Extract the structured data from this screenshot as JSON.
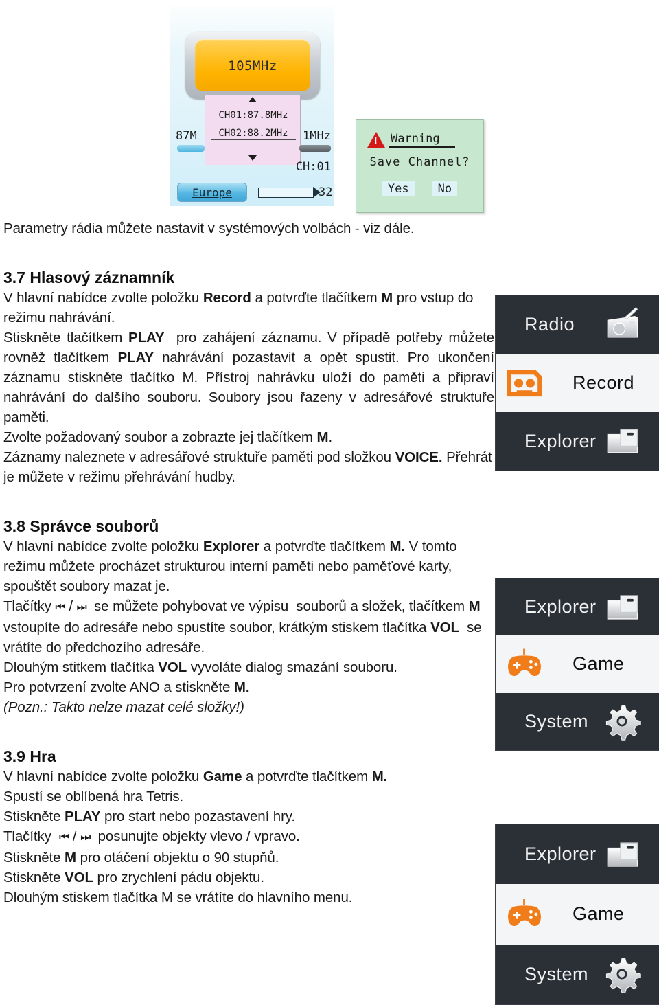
{
  "device_screens": {
    "radio": {
      "name": "radio-tuner-screen",
      "frequency": "105MHz",
      "channels": [
        "CH01:87.8MHz",
        "CH02:88.2MHz"
      ],
      "scale_min": "87M",
      "scale_max": "1MHz",
      "current_channel": "CH:01",
      "region": "Europe",
      "volume": "32"
    },
    "warning": {
      "name": "save-channel-dialog",
      "title": "Warning",
      "message": "Save  Channel?",
      "buttons": [
        "Yes",
        "No"
      ],
      "bg_color": "#c7e8ce",
      "icon_color": "#d31a18"
    }
  },
  "doc": {
    "intro": "Parametry rádia můžete nastavit v systémových volbách - viz dále.",
    "section_37": {
      "heading": "3.7 Hlasový záznamník",
      "paragraphs": [
        "V hlavní nabídce zvolte položku <b>Record</b> a potvrďte tlačítkem <b>M</b> pro vstup do režimu nahrávání.",
        "Stiskněte tlačítkem <b>PLAY</b>&nbsp; pro zahájení záznamu. V případě potřeby můžete rovněž tlačítkem <b>PLAY</b> nahrávání pozastavit a opět spustit. Pro ukončení záznamu stiskněte tlačítko M. Přístroj nahrávku uloží do paměti a připraví nahrávání do dalšího souboru. Soubory jsou řazeny v adresářové struktuře paměti.",
        "Zvolte požadovaný soubor a zobrazte jej tlačítkem <b>M</b>.",
        "Záznamy naleznete v adresářové struktuře paměti pod složkou <b>VOICE.</b> Přehrát je můžete v režimu přehrávání hudby."
      ]
    },
    "section_38": {
      "heading": "3.8 Správce souborů",
      "paragraphs": [
        "V hlavní nabídce zvolte položku <b>Explorer</b> a potvrďte tlačítkem <b>M.</b> V tomto režimu můžete procházet strukturou interní paměti nebo paměťové karty, spouštět soubory mazat je.",
        "Tlačítky <span class=\"glyph\">⏮</span> / <span class=\"glyph\">⏭</span>&nbsp; se můžete pohybovat ve výpisu&nbsp; souborů a složek, tlačítkem <b>M</b> vstoupíte do adresáře nebo spustíte soubor, krátkým stiskem tlačítka <b>VOL</b>&nbsp; se vrátíte do předchozího adresáře.",
        "Dlouhým stitkem tlačítka <b>VOL</b> vyvoláte dialog smazání souboru.",
        "Pro potvrzení zvolte ANO a stiskněte <b>M.</b>",
        "<i>(Pozn.: Takto nelze mazat celé složky!)</i>"
      ]
    },
    "section_39": {
      "heading": "3.9 Hra",
      "paragraphs": [
        "V hlavní nabídce zvolte položku <b>Game</b> a potvrďte tlačítkem <b>M.</b>",
        "Spustí se oblíbená hra Tetris.",
        "Stiskněte <b>PLAY</b> pro start nebo pozastavení hry.",
        "Tlačítky&nbsp; <span class=\"glyph\">⏮</span> / <span class=\"glyph\">⏭</span>&nbsp; posunujte objekty vlevo / vpravo.",
        "Stiskněte <b>M</b> pro otáčení objektu o 90 stupňů.",
        "Stiskněte <b>VOL</b> pro zrychlení pádu objektu.",
        "Dlouhým stiskem tlačítka M se vrátíte do hlavního menu."
      ]
    }
  },
  "menu_images": [
    {
      "name": "device-menu-record",
      "rows": [
        {
          "label": "Radio",
          "icon": "radio-icon",
          "selected": false
        },
        {
          "label": "Record",
          "icon": "cassette-icon",
          "selected": true
        },
        {
          "label": "Explorer",
          "icon": "folder-icon",
          "selected": false
        }
      ]
    },
    {
      "name": "device-menu-game-1",
      "rows": [
        {
          "label": "Explorer",
          "icon": "folder-icon",
          "selected": false
        },
        {
          "label": "Game",
          "icon": "gamepad-icon",
          "selected": true
        },
        {
          "label": "System",
          "icon": "gear-icon",
          "selected": false
        }
      ]
    },
    {
      "name": "device-menu-game-2",
      "rows": [
        {
          "label": "Explorer",
          "icon": "folder-icon",
          "selected": false
        },
        {
          "label": "Game",
          "icon": "gamepad-icon",
          "selected": true
        },
        {
          "label": "System",
          "icon": "gear-icon",
          "selected": false
        }
      ]
    }
  ],
  "theme": {
    "accent_orange": "#f07d1a",
    "menu_dark": "#2b2f36",
    "menu_light": "#f4f5f7"
  }
}
